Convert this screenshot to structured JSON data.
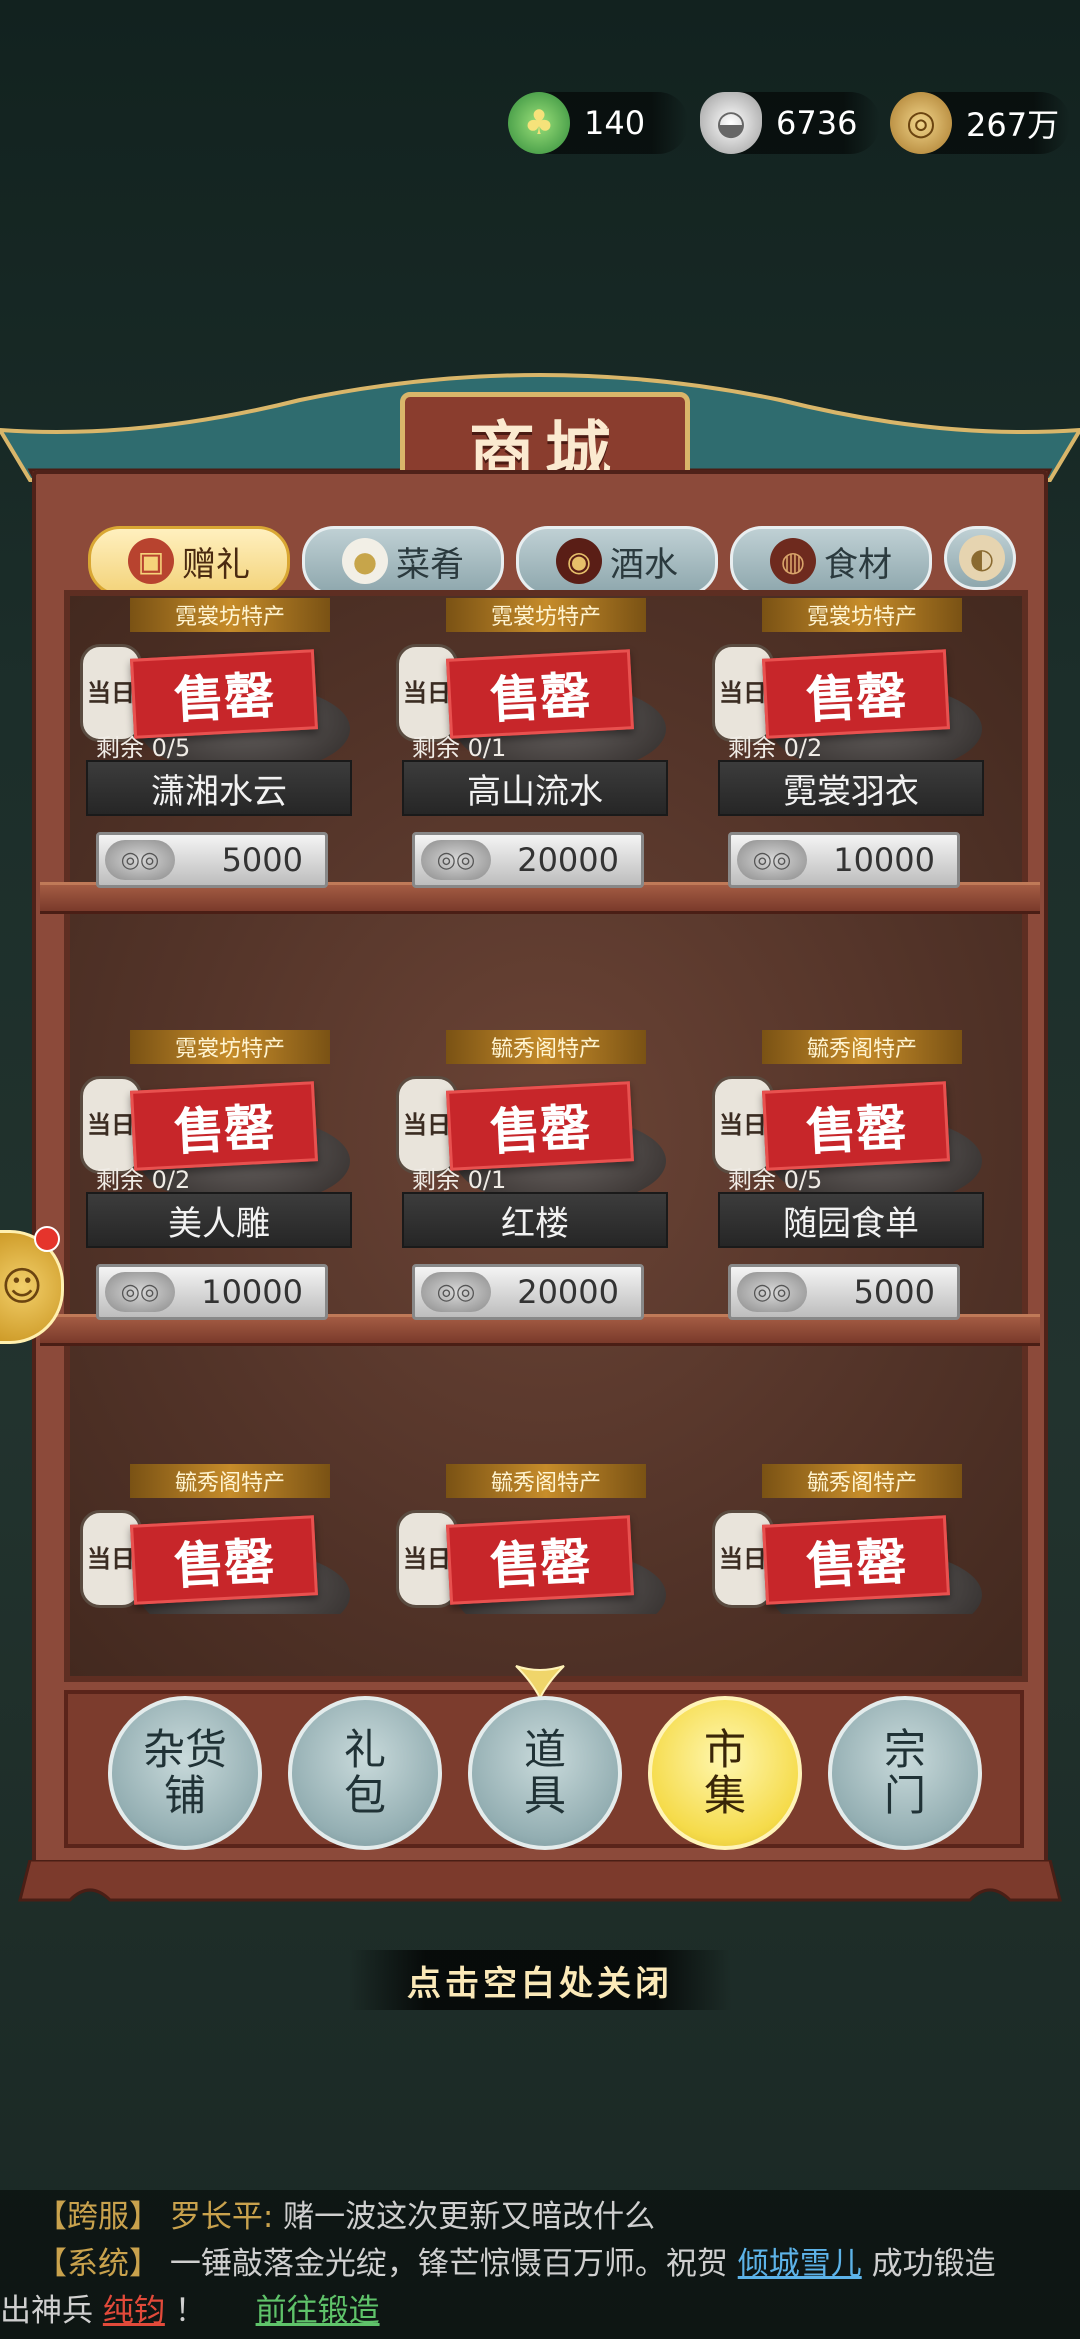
{
  "currency": {
    "jade": {
      "value": "140",
      "icon": "jade-frog-icon"
    },
    "silver": {
      "value": "6736",
      "icon": "silver-ingot-icon"
    },
    "coins": {
      "value": "267万",
      "icon": "copper-coins-icon"
    }
  },
  "shop": {
    "title": "商城",
    "tabs": [
      {
        "label": "赠礼",
        "icon": "gift-chest-icon",
        "active": true
      },
      {
        "label": "菜肴",
        "icon": "dish-icon",
        "active": false
      },
      {
        "label": "酒水",
        "icon": "wine-jar-icon",
        "active": false
      },
      {
        "label": "食材",
        "icon": "ingredient-icon",
        "active": false
      }
    ],
    "items": [
      {
        "tag": "霓裳坊特产",
        "lantern": "当日",
        "sold": "售罄",
        "remain": "剩余 0/5",
        "name": "潇湘水云",
        "price": "5000"
      },
      {
        "tag": "霓裳坊特产",
        "lantern": "当日",
        "sold": "售罄",
        "remain": "剩余 0/1",
        "name": "高山流水",
        "price": "20000"
      },
      {
        "tag": "霓裳坊特产",
        "lantern": "当日",
        "sold": "售罄",
        "remain": "剩余 0/2",
        "name": "霓裳羽衣",
        "price": "10000"
      },
      {
        "tag": "霓裳坊特产",
        "lantern": "当日",
        "sold": "售罄",
        "remain": "剩余 0/2",
        "name": "美人雕",
        "price": "10000"
      },
      {
        "tag": "毓秀阁特产",
        "lantern": "当日",
        "sold": "售罄",
        "remain": "剩余 0/1",
        "name": "红楼",
        "price": "20000"
      },
      {
        "tag": "毓秀阁特产",
        "lantern": "当日",
        "sold": "售罄",
        "remain": "剩余 0/5",
        "name": "随园食单",
        "price": "5000"
      },
      {
        "tag": "毓秀阁特产",
        "lantern": "当日",
        "sold": "售罄"
      },
      {
        "tag": "毓秀阁特产",
        "lantern": "当日",
        "sold": "售罄"
      },
      {
        "tag": "毓秀阁特产",
        "lantern": "当日",
        "sold": "售罄"
      }
    ],
    "nav": [
      {
        "label": "杂货\n铺",
        "l1": "杂货",
        "l2": "铺",
        "active": false
      },
      {
        "label": "礼包",
        "l1": "礼",
        "l2": "包",
        "active": false
      },
      {
        "label": "道具",
        "l1": "道",
        "l2": "具",
        "active": false
      },
      {
        "label": "市集",
        "l1": "市",
        "l2": "集",
        "active": true
      },
      {
        "label": "宗门",
        "l1": "宗",
        "l2": "门",
        "active": false
      }
    ],
    "close_hint": "点击空白处关闭"
  },
  "chat": {
    "line1": {
      "channel": "【跨服】",
      "speaker": "罗长平:",
      "text": "赌一波这次更新又暗改什么"
    },
    "line2": {
      "channel": "【系统】",
      "text": "一锤敲落金光绽，锋芒惊慑百万师。祝贺",
      "player": "倾城雪儿",
      "text2": "成功锻造"
    },
    "line3": {
      "text": "出神兵",
      "weapon": "纯钧",
      "text2": "！",
      "link": "前往锻造"
    }
  },
  "colors": {
    "accent_gold": "#f3d37a",
    "sold_red": "#c7262a",
    "cabinet": "#8c4a3a"
  }
}
